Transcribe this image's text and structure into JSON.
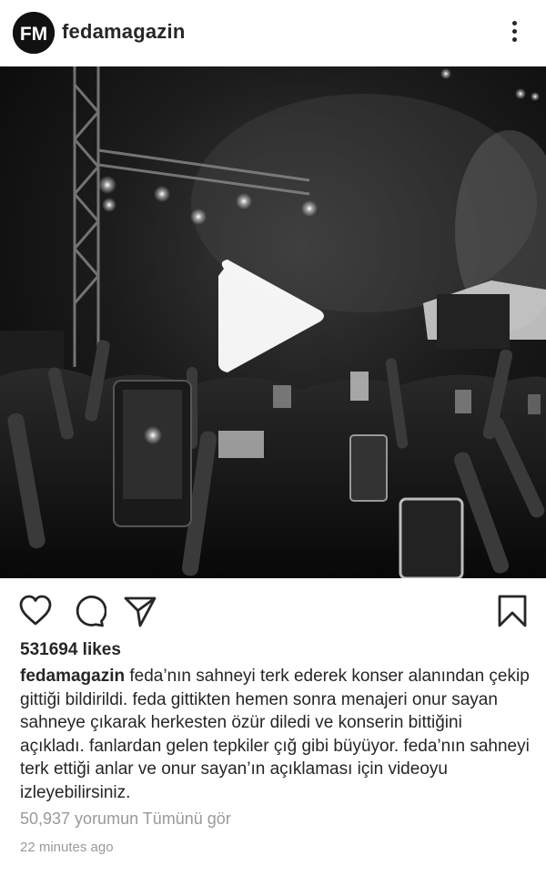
{
  "post": {
    "username": "fedamagazin",
    "avatar_text": "FM",
    "likes": "531694 likes",
    "caption_user": "fedamagazin",
    "caption_text": "feda’nın sahneyi terk ederek konser alanından çekip gittiği bildirildi. feda gittikten hemen sonra menajeri onur sayan sahneye çıkarak herkesten özür diledi ve konserin bittiğini açıkladı. fanlardan gelen tepkiler çığ gibi büyüyor. feda’nın sahneyi terk ettiği anlar ve onur sayan’ın açıklaması için videoyu izleyebilirsiniz.",
    "view_comments": "50,937 yorumun Tümünü gör",
    "timestamp": "22 minutes ago"
  },
  "icons": {
    "more": "more-icon",
    "play": "play-icon",
    "like": "heart-icon",
    "comment": "comment-icon",
    "share": "send-icon",
    "save": "bookmark-icon"
  },
  "colors": {
    "text": "#262626",
    "muted": "#999999",
    "background": "#ffffff"
  }
}
